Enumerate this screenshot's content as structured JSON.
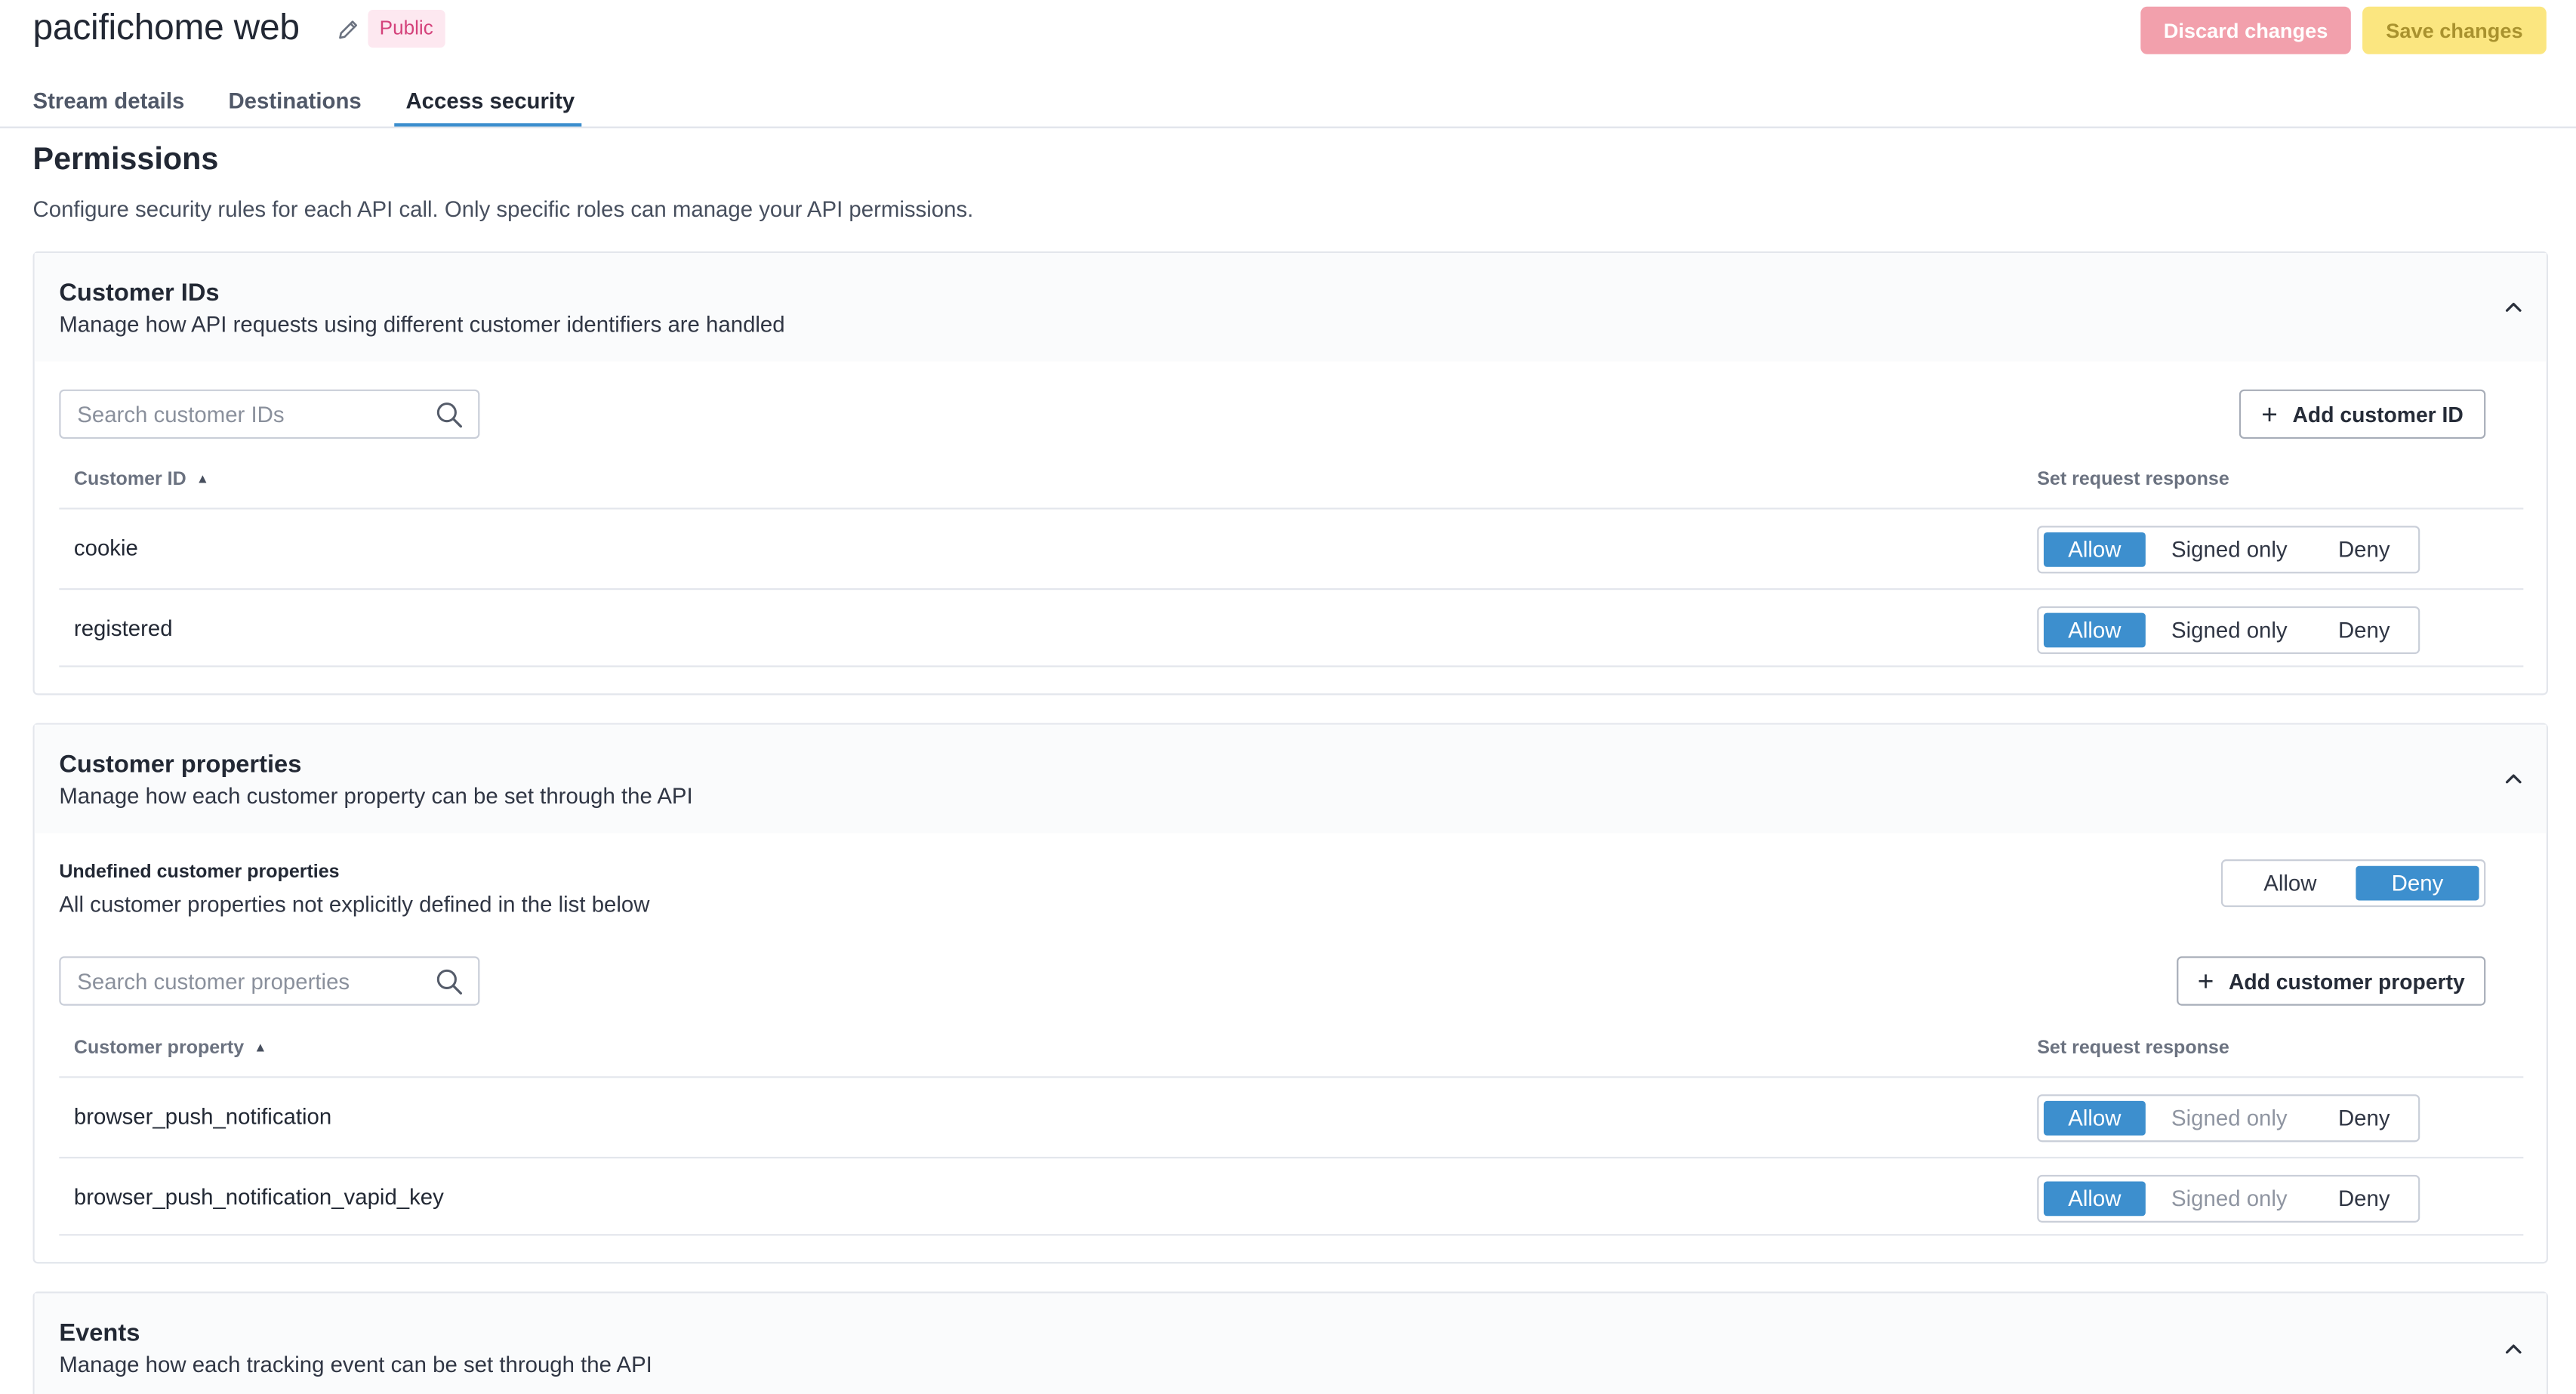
{
  "header": {
    "title": "pacifichome web",
    "badge": "Public",
    "discard_label": "Discard changes",
    "save_label": "Save changes"
  },
  "tabs": [
    {
      "label": "Stream details"
    },
    {
      "label": "Destinations"
    },
    {
      "label": "Access security",
      "active": true
    }
  ],
  "permissions": {
    "title": "Permissions",
    "description": "Configure security rules for each API call. Only specific roles can manage your API permissions."
  },
  "customer_ids": {
    "title": "Customer IDs",
    "subtitle": "Manage how API requests using different customer identifiers are handled",
    "search_placeholder": "Search customer IDs",
    "add_label": "Add customer ID",
    "col_name": "Customer ID",
    "col_response": "Set request response",
    "rows": [
      {
        "name": "cookie",
        "response": "Allow"
      },
      {
        "name": "registered",
        "response": "Allow"
      }
    ]
  },
  "customer_properties": {
    "title": "Customer properties",
    "subtitle": "Manage how each customer property can be set through the API",
    "undefined_title": "Undefined customer properties",
    "undefined_sub": "All customer properties not explicitly defined in the list below",
    "undefined_response": "Deny",
    "search_placeholder": "Search customer properties",
    "add_label": "Add customer property",
    "col_name": "Customer property",
    "col_response": "Set request response",
    "rows": [
      {
        "name": "browser_push_notification",
        "response": "Allow",
        "signed_disabled": true
      },
      {
        "name": "browser_push_notification_vapid_key",
        "response": "Allow",
        "signed_disabled": true
      }
    ]
  },
  "events": {
    "title": "Events",
    "subtitle": "Manage how each tracking event can be set through the API"
  },
  "options": {
    "allow": "Allow",
    "signed_only": "Signed only",
    "deny": "Deny"
  },
  "colors": {
    "accent": "#3d8fce",
    "discard_bg": "#f2a0ac",
    "save_bg": "#fbe680",
    "badge_text": "#d4427b",
    "badge_bg": "#fde8f0"
  },
  "icons": {
    "edit": "pencil-icon",
    "search": "search-icon",
    "add": "plus-icon",
    "collapse": "chevron-up-icon",
    "sort": "sort-ascending-icon"
  }
}
